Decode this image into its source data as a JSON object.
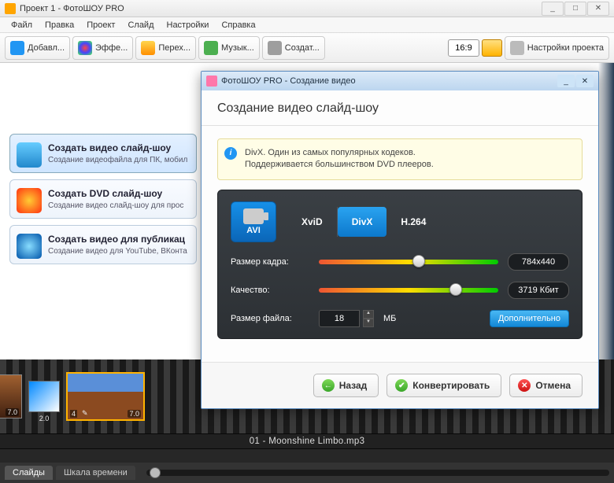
{
  "window": {
    "title": "Проект 1 - ФотоШОУ PRO"
  },
  "menu": [
    "Файл",
    "Правка",
    "Проект",
    "Слайд",
    "Настройки",
    "Справка"
  ],
  "toolbar": {
    "add": "Добавл...",
    "effects": "Эффе...",
    "transitions": "Перех...",
    "music": "Музык...",
    "create": "Создат...",
    "ratio": "16:9",
    "project_settings": "Настройки проекта"
  },
  "sidebar": {
    "items": [
      {
        "title": "Создать видео слайд-шоу",
        "desc": "Создание видеофайла для ПК, мобил"
      },
      {
        "title": "Создать DVD слайд-шоу",
        "desc": "Создание видео слайд-шоу для прос"
      },
      {
        "title": "Создать видео для публикац",
        "desc": "Создание видео для YouTube, ВКонта"
      }
    ]
  },
  "timeline": {
    "audio": "01 - Moonshine Limbo.mp3",
    "tab_slides": "Слайды",
    "tab_time": "Шкала времени",
    "slides": [
      {
        "dur": "7.0"
      },
      {
        "dur": "2.0",
        "trans": true
      },
      {
        "idx": "4",
        "dur": "7.0",
        "sel": true
      }
    ]
  },
  "dialog": {
    "title": "ФотоШОУ PRO - Создание видео",
    "heading": "Создание видео слайд-шоу",
    "info1": "DivX. Один из самых популярных кодеков.",
    "info2": "Поддерживается большинством DVD плееров.",
    "format": "AVI",
    "codecs": [
      "XviD",
      "DivX",
      "H.264"
    ],
    "codec_active": 1,
    "size_label": "Размер кадра:",
    "size_value": "784x440",
    "quality_label": "Качество:",
    "quality_value": "3719 Кбит",
    "file_label": "Размер файла:",
    "file_value": "18",
    "file_unit": "МБ",
    "advanced": "Дополнительно",
    "back": "Назад",
    "convert": "Конвертировать",
    "cancel": "Отмена"
  }
}
